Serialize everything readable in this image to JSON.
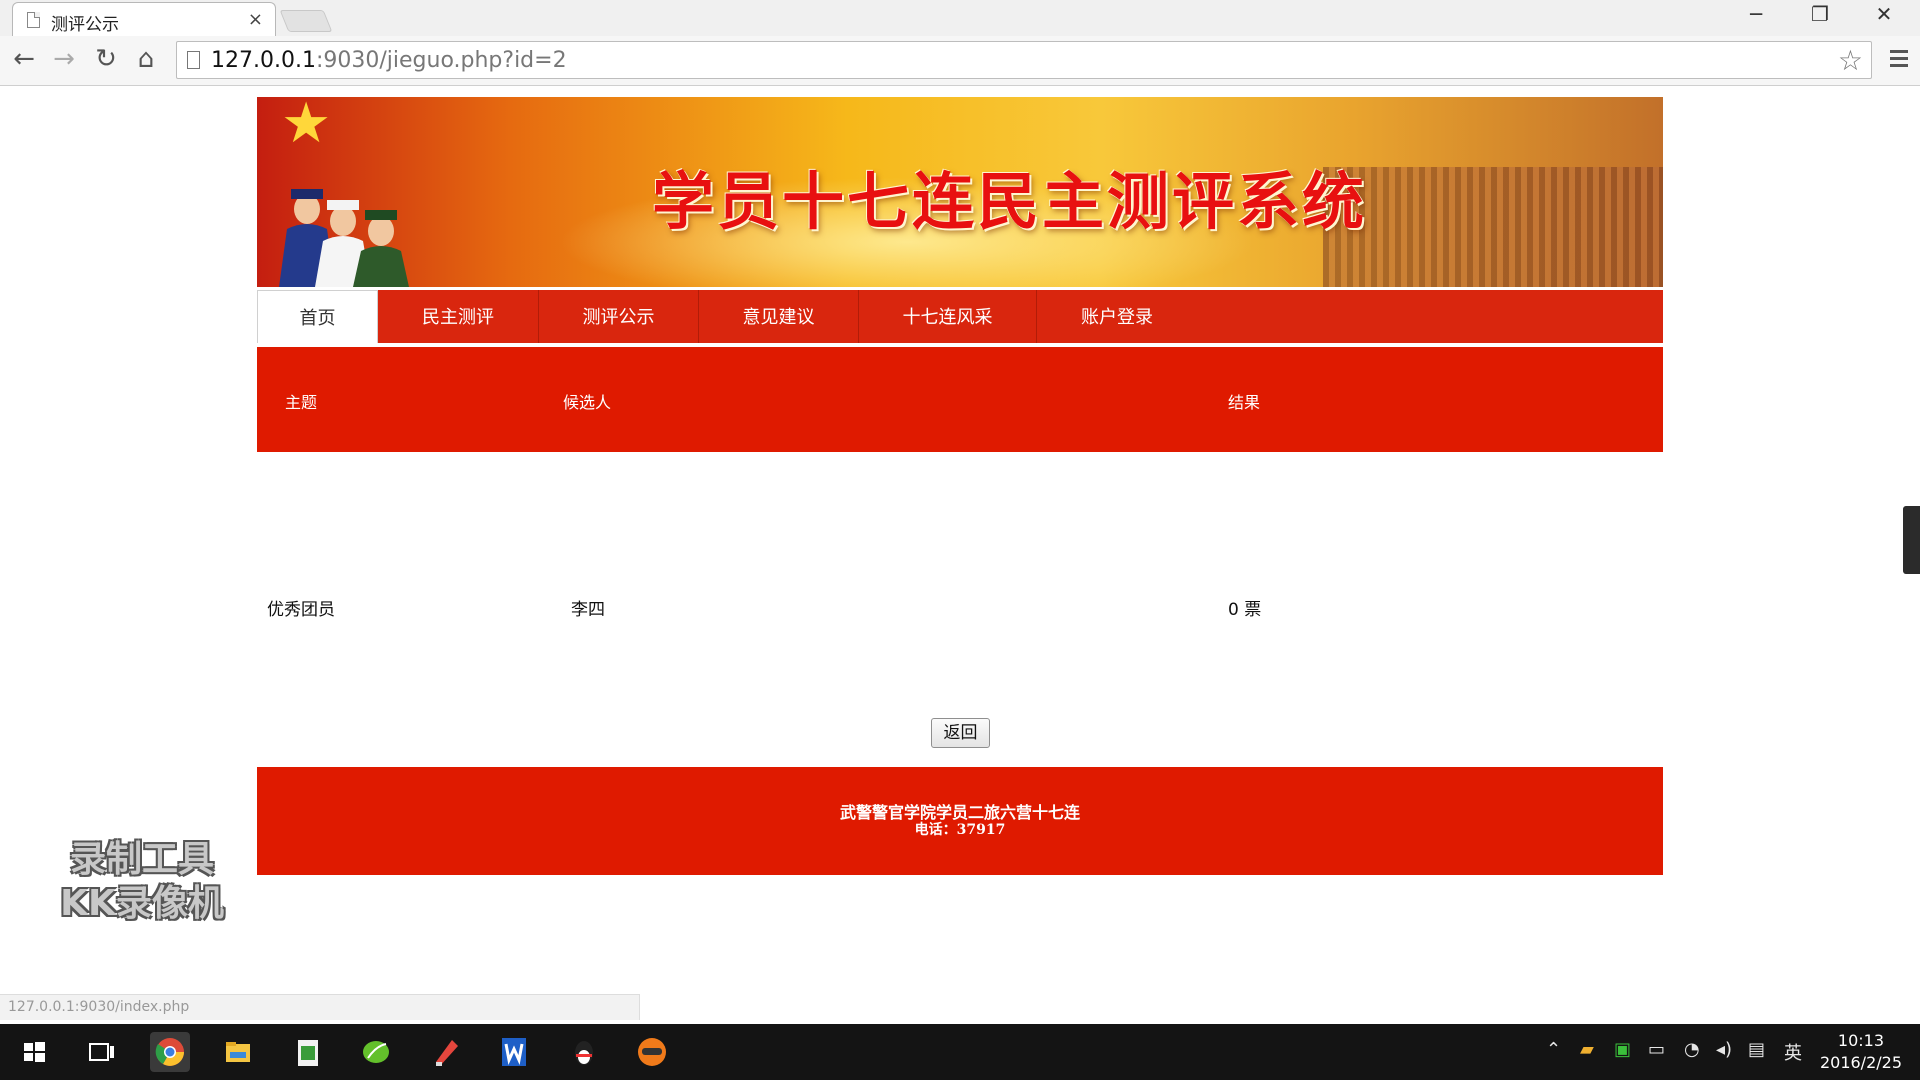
{
  "browser": {
    "tab_title": "测评公示",
    "tab_close": "×",
    "url_host": "127.0.0.1",
    "url_rest": ":9030/jieguo.php?id=2",
    "status_url": "127.0.0.1:9030/index.php",
    "window_controls": {
      "minimize": "─",
      "restore": "❐",
      "close": "✕"
    }
  },
  "banner": {
    "headline": "学员十七连民主测评系统"
  },
  "nav": [
    {
      "label": "首页"
    },
    {
      "label": "民主测评"
    },
    {
      "label": "测评公示"
    },
    {
      "label": "意见建议"
    },
    {
      "label": "十七连风采"
    },
    {
      "label": "账户登录"
    }
  ],
  "table": {
    "headers": {
      "topic": "主题",
      "candidate": "候选人",
      "result": "结果"
    },
    "rows": [
      {
        "topic": "优秀团员",
        "candidate": "李四",
        "result": "0 票"
      }
    ]
  },
  "back_button": "返回",
  "footer": {
    "line1": "武警警官学院学员二旅六营十七连",
    "line2": "电话：37917"
  },
  "watermark": {
    "line1": "录制工具",
    "line2": "KK录像机"
  },
  "taskbar": {
    "apps": [
      "windows-start",
      "task-view",
      "chrome",
      "file-explorer",
      "spreadsheet-app",
      "green-leaf-app",
      "pen-app",
      "wps-writer",
      "qq",
      "orange-app"
    ],
    "ime": "英",
    "time": "10:13",
    "date": "2016/2/25"
  }
}
